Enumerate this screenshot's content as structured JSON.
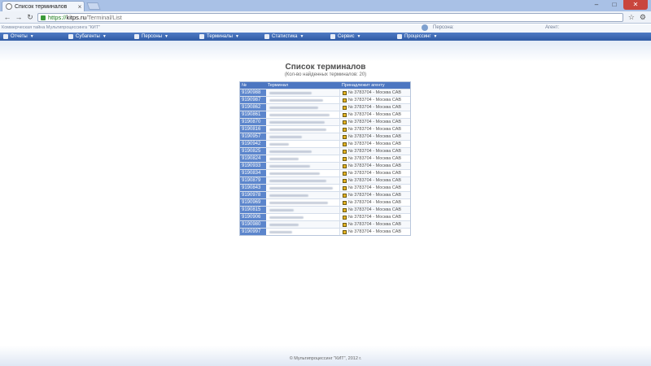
{
  "browser": {
    "tab_title": "Список терминалов",
    "url_scheme": "https://",
    "url_host": "kitps.ru",
    "url_path": "/Terminal/List"
  },
  "header": {
    "info_left": "Коммерческая тайна Мультипроцессинга \"КИТ\"",
    "person_label": "Персона:",
    "agent_label": "Агент:"
  },
  "menu": [
    {
      "label": "Отчеты",
      "icon": "report-icon"
    },
    {
      "label": "Субагенты",
      "icon": "subagents-icon"
    },
    {
      "label": "Персоны",
      "icon": "persons-icon"
    },
    {
      "label": "Терминалы",
      "icon": "terminals-icon"
    },
    {
      "label": "Статистика",
      "icon": "statistics-icon"
    },
    {
      "label": "Сервис",
      "icon": "service-icon"
    },
    {
      "label": "Процессинг",
      "icon": "processing-icon"
    }
  ],
  "main": {
    "title": "Список терминалов",
    "subtitle": "(Кол-во найденных терминалов: 20)",
    "columns": [
      "№",
      "Терминал",
      "Принадлежит агенту"
    ],
    "rows": [
      {
        "num": "9190988",
        "agent": "№ 3783704 - Москва САВ"
      },
      {
        "num": "9190987",
        "agent": "№ 3783704 - Москва САВ"
      },
      {
        "num": "9190862",
        "agent": "№ 3783704 - Москва САВ"
      },
      {
        "num": "9190861",
        "agent": "№ 3783704 - Москва САВ"
      },
      {
        "num": "9190870",
        "agent": "№ 3783704 - Москва САВ"
      },
      {
        "num": "9190816",
        "agent": "№ 3783704 - Москва САВ"
      },
      {
        "num": "9190957",
        "agent": "№ 3783704 - Москва САВ"
      },
      {
        "num": "9190942",
        "agent": "№ 3783704 - Москва САВ"
      },
      {
        "num": "9190825",
        "agent": "№ 3783704 - Москва САВ"
      },
      {
        "num": "9190824",
        "agent": "№ 3783704 - Москва САВ"
      },
      {
        "num": "9190933",
        "agent": "№ 3783704 - Москва САВ"
      },
      {
        "num": "9190834",
        "agent": "№ 3783704 - Москва САВ"
      },
      {
        "num": "9190879",
        "agent": "№ 3783704 - Москва САВ"
      },
      {
        "num": "9190843",
        "agent": "№ 3783704 - Москва САВ"
      },
      {
        "num": "9190978",
        "agent": "№ 3783704 - Москва САВ"
      },
      {
        "num": "9190969",
        "agent": "№ 3783704 - Москва САВ"
      },
      {
        "num": "9190815",
        "agent": "№ 3783704 - Москва САВ"
      },
      {
        "num": "9190906",
        "agent": "№ 3783704 - Москва САВ"
      },
      {
        "num": "9190980",
        "agent": "№ 3783704 - Москва САВ"
      },
      {
        "num": "9190997",
        "agent": "№ 3783704 - Москва САВ"
      }
    ]
  },
  "footer": {
    "copyright": "© Мультипроцессинг \"КИТ\", 2012 г."
  }
}
